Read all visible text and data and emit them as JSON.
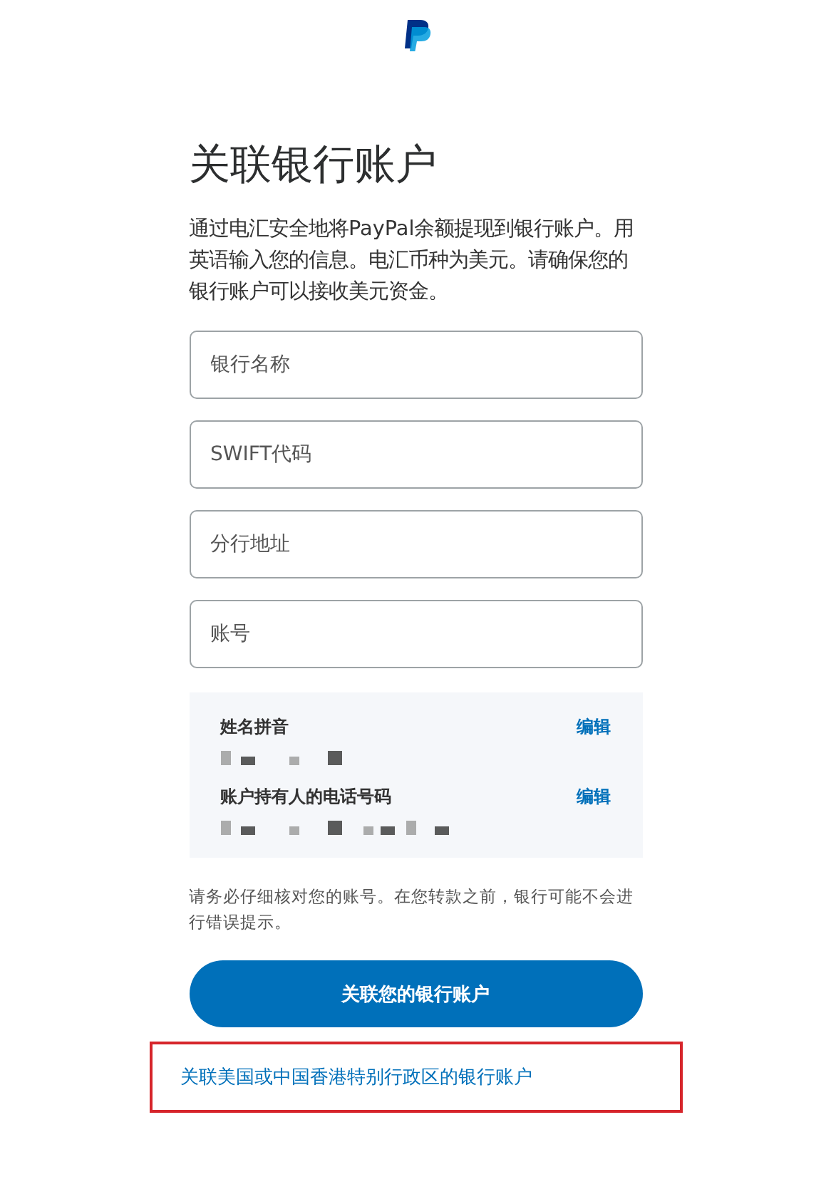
{
  "title": "关联银行账户",
  "intro": "通过电汇安全地将PayPal余额提现到银行账户。用英语输入您的信息。电汇币种为美元。请确保您的银行账户可以接收美元资金。",
  "fields": [
    {
      "placeholder": "银行名称"
    },
    {
      "placeholder": "SWIFT代码"
    },
    {
      "placeholder": "分行地址"
    },
    {
      "placeholder": "账号"
    }
  ],
  "details": [
    {
      "label": "姓名拼音",
      "action": "编辑"
    },
    {
      "label": "账户持有人的电话号码",
      "action": "编辑"
    }
  ],
  "note": "请务必仔细核对您的账号。在您转款之前，银行可能不会进行错误提示。",
  "primary_button": "关联您的银行账户",
  "secondary_link": {
    "text": "关联美国或中国香港特别行政区的银行账户",
    "highlighted": true
  }
}
